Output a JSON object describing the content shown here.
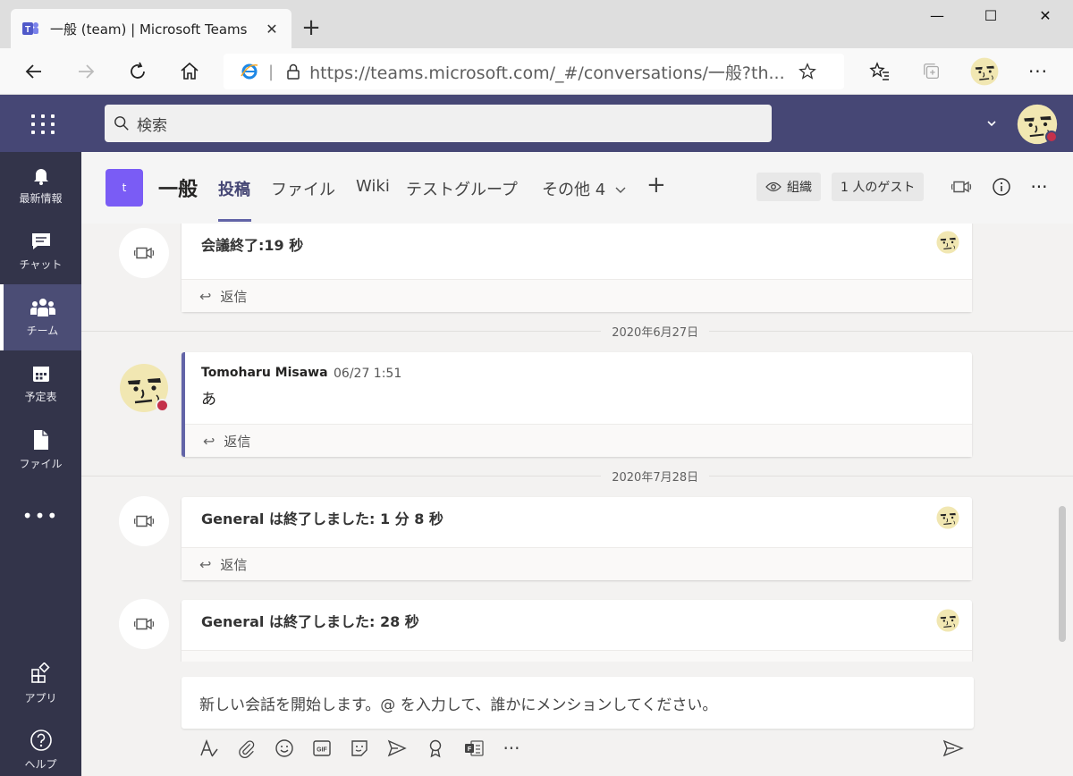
{
  "browser": {
    "tab_title": "一般 (team) | Microsoft Teams",
    "url": "https://teams.microsoft.com/_#/conversations/一般?th..."
  },
  "search": {
    "placeholder": "検索"
  },
  "rail": {
    "items": [
      {
        "label": "最新情報",
        "icon": "bell-icon"
      },
      {
        "label": "チャット",
        "icon": "chat-icon"
      },
      {
        "label": "チーム",
        "icon": "teams-icon"
      },
      {
        "label": "予定表",
        "icon": "calendar-icon"
      },
      {
        "label": "ファイル",
        "icon": "file-icon"
      }
    ],
    "more": "•••",
    "apps": "アプリ",
    "help": "ヘルプ"
  },
  "channel": {
    "team_initial": "t",
    "name": "一般",
    "tabs": [
      "投稿",
      "ファイル",
      "Wiki",
      "テストグループ",
      "その他 4"
    ],
    "org_label": "組織",
    "guest_label": "1 人のゲスト"
  },
  "feed": {
    "reply_label": "返信",
    "items": [
      {
        "type": "meeting",
        "text": "会議終了:19 秒"
      },
      {
        "type": "date",
        "text": "2020年6月27日"
      },
      {
        "type": "message",
        "author": "Tomoharu Misawa",
        "time": "06/27 1:51",
        "text": "あ"
      },
      {
        "type": "date",
        "text": "2020年7月28日"
      },
      {
        "type": "meeting",
        "text": "General は終了しました: 1 分 8 秒"
      },
      {
        "type": "meeting",
        "text": "General は終了しました: 28 秒"
      }
    ]
  },
  "compose": {
    "placeholder": "新しい会話を開始します。@ を入力して、誰かにメンションしてください。"
  },
  "colors": {
    "teams_header": "#464775",
    "rail": "#33344a",
    "accent": "#6264a7",
    "team_avatar": "#7a5cf5",
    "presence_busy": "#c4314b"
  }
}
